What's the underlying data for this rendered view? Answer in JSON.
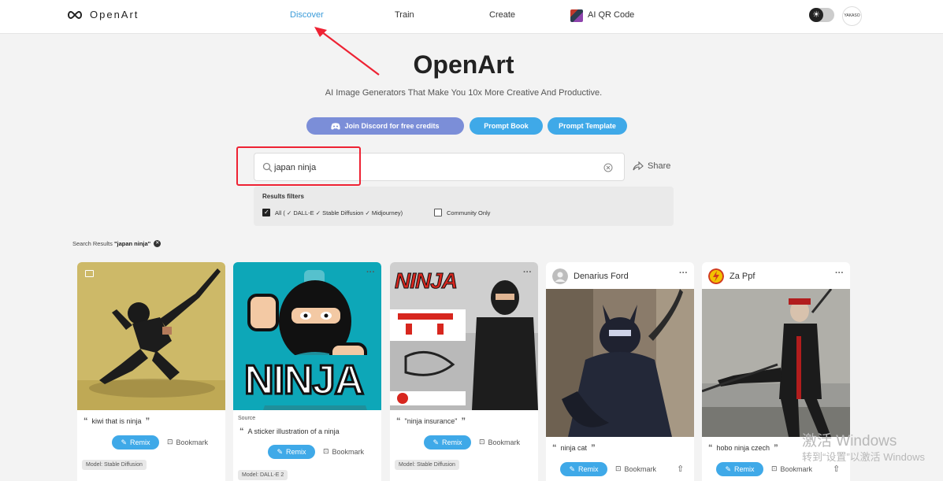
{
  "header": {
    "brand": "OpenArt",
    "nav": [
      {
        "label": "Discover",
        "active": true
      },
      {
        "label": "Train",
        "active": false
      },
      {
        "label": "Create",
        "active": false
      },
      {
        "label": "AI QR Code",
        "active": false
      }
    ],
    "user_avatar_text": "YAKASO"
  },
  "hero": {
    "title": "OpenArt",
    "subtitle": "AI Image Generators That Make You 10x More Creative And Productive.",
    "buttons": {
      "discord": "Join Discord for free credits",
      "prompt_book": "Prompt Book",
      "prompt_template": "Prompt Template"
    }
  },
  "search": {
    "value": "japan ninja",
    "share_label": "Share"
  },
  "filters": {
    "title": "Results filters",
    "options": [
      {
        "label": "All ( ✓ DALL-E ✓ Stable Diffusion ✓ Midjourney)",
        "checked": true
      },
      {
        "label": "Community Only",
        "checked": false
      }
    ]
  },
  "results": {
    "prefix": "Search Results ",
    "query": "\"japan ninja\""
  },
  "cards": [
    {
      "user": "",
      "prompt": "kiwi that is ninja",
      "source": "",
      "remix": "Remix",
      "bookmark": "Bookmark",
      "model": "Model: Stable Diffusion"
    },
    {
      "user": "",
      "prompt": "A sticker illustration of a ninja",
      "source": "Source",
      "remix": "Remix",
      "bookmark": "Bookmark",
      "model": "Model: DALL-E 2",
      "image_text": "NINJA"
    },
    {
      "user": "",
      "prompt": "\"ninja insurance\"",
      "source": "",
      "remix": "Remix",
      "bookmark": "Bookmark",
      "model": "Model: Stable Diffusion",
      "image_text": "NINJA"
    },
    {
      "user": "Denarius Ford",
      "prompt": "ninja cat",
      "source": "",
      "remix": "Remix",
      "bookmark": "Bookmark",
      "model": ""
    },
    {
      "user": "Za Ppf",
      "prompt": "hobo ninja czech",
      "source": "",
      "remix": "Remix",
      "bookmark": "Bookmark",
      "model": ""
    }
  ],
  "overlay": {
    "watermark_line1": "激活 Windows",
    "watermark_line2": "转到“设置”以激活 Windows"
  },
  "colors": {
    "accent": "#3fa9e8",
    "discord": "#7b8ed8",
    "annotation": "#ee2233"
  }
}
